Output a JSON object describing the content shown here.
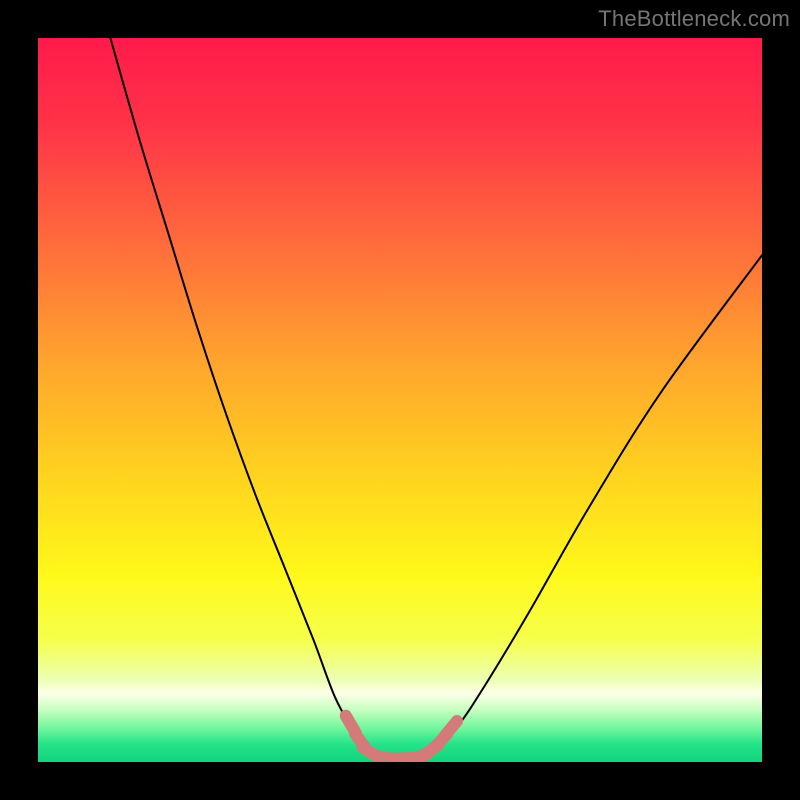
{
  "watermark": "TheBottleneck.com",
  "chart_data": {
    "type": "line",
    "title": "",
    "xlabel": "",
    "ylabel": "",
    "xlim": [
      0,
      100
    ],
    "ylim": [
      0,
      100
    ],
    "curve_main": {
      "name": "bottleneck-curve",
      "stroke": "#000000",
      "stroke_width": 2,
      "x": [
        10,
        14,
        18,
        22,
        26,
        30,
        34,
        38,
        41,
        43.5,
        45.5,
        47,
        49,
        51,
        53,
        55,
        58,
        62,
        68,
        76,
        86,
        100
      ],
      "y": [
        100,
        86,
        73,
        60,
        48,
        37,
        27,
        17,
        9,
        4.5,
        2,
        0.8,
        0.4,
        0.4,
        0.9,
        2.2,
        5,
        11,
        21,
        35,
        51,
        70
      ]
    },
    "markers": {
      "name": "bottom-markers",
      "stroke": "#d47a78",
      "stroke_width": 12,
      "linecap": "round",
      "points": [
        {
          "x": 43.2,
          "y": 5.2
        },
        {
          "x": 44.6,
          "y": 2.8
        },
        {
          "x": 46.0,
          "y": 1.3
        },
        {
          "x": 48.0,
          "y": 0.6
        },
        {
          "x": 50.2,
          "y": 0.5
        },
        {
          "x": 52.4,
          "y": 0.7
        },
        {
          "x": 54.2,
          "y": 1.6
        },
        {
          "x": 55.6,
          "y": 2.9
        },
        {
          "x": 57.0,
          "y": 4.6
        }
      ]
    },
    "gradient_stops": [
      {
        "offset": 0.0,
        "color": "#ff1a4a"
      },
      {
        "offset": 0.12,
        "color": "#ff3348"
      },
      {
        "offset": 0.28,
        "color": "#ff6a3c"
      },
      {
        "offset": 0.44,
        "color": "#ffa22e"
      },
      {
        "offset": 0.6,
        "color": "#ffd21f"
      },
      {
        "offset": 0.74,
        "color": "#fff81a"
      },
      {
        "offset": 0.83,
        "color": "#f6ff4a"
      },
      {
        "offset": 0.885,
        "color": "#ecffb0"
      },
      {
        "offset": 0.905,
        "color": "#fdffe8"
      },
      {
        "offset": 0.928,
        "color": "#c7ffc0"
      },
      {
        "offset": 0.955,
        "color": "#6cf59b"
      },
      {
        "offset": 0.975,
        "color": "#26e38a"
      },
      {
        "offset": 1.0,
        "color": "#0fd57d"
      }
    ]
  }
}
